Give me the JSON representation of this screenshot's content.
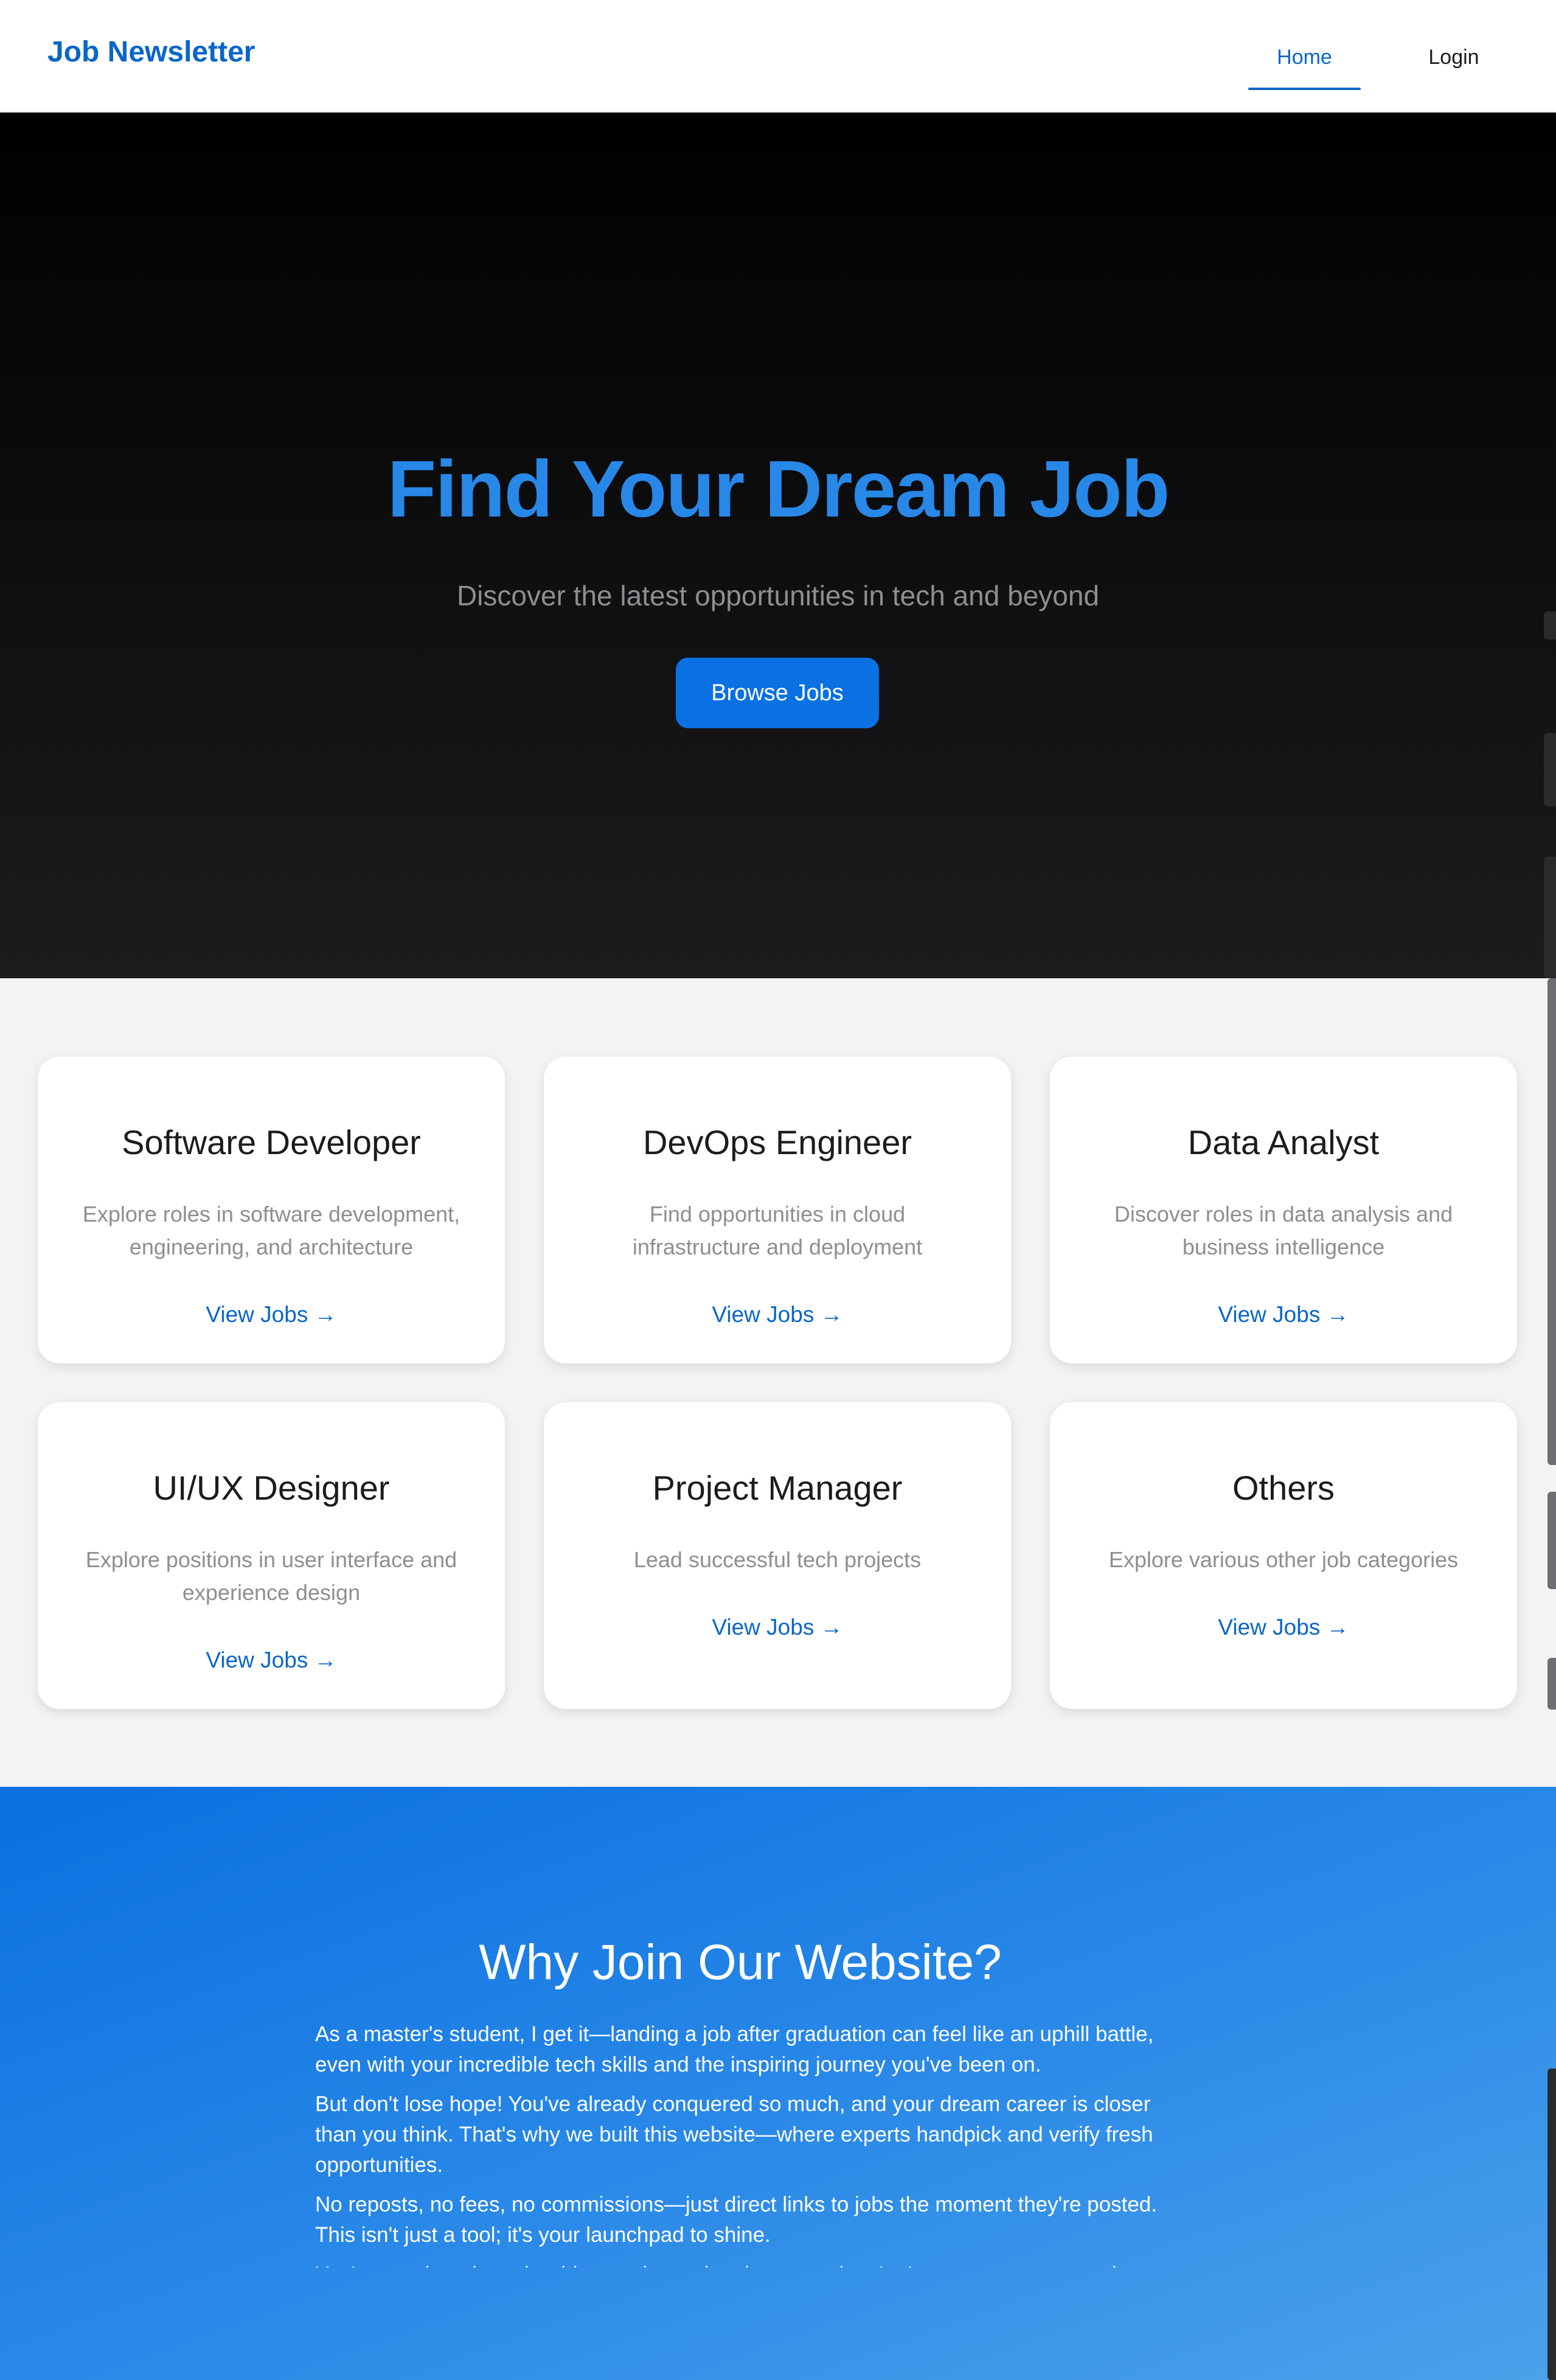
{
  "navbar": {
    "brand": "Job Newsletter",
    "links": [
      {
        "label": "Home",
        "active": true
      },
      {
        "label": "Login",
        "active": false
      }
    ]
  },
  "hero": {
    "title": "Find Your Dream Job",
    "subtitle": "Discover the latest opportunities in tech and beyond",
    "button_label": "Browse Jobs"
  },
  "categories": [
    {
      "title": "Software Developer",
      "description": "Explore roles in software development, engineering, and architecture",
      "link_label": "View Jobs →"
    },
    {
      "title": "DevOps Engineer",
      "description": "Find opportunities in cloud infrastructure and deployment",
      "link_label": "View Jobs →"
    },
    {
      "title": "Data Analyst",
      "description": "Discover roles in data analysis and business intelligence",
      "link_label": "View Jobs →"
    },
    {
      "title": "UI/UX Designer",
      "description": "Explore positions in user interface and experience design",
      "link_label": "View Jobs →"
    },
    {
      "title": "Project Manager",
      "description": "Lead successful tech projects",
      "link_label": "View Jobs →"
    },
    {
      "title": "Others",
      "description": "Explore various other job categories",
      "link_label": "View Jobs →"
    }
  ],
  "why": {
    "title": "Why Join Our Website?",
    "paragraphs": [
      "As a master's student, I get it—landing a job after graduation can feel like an uphill battle, even with your incredible tech skills and the inspiring journey you've been on.",
      "But don't lose hope! You've already conquered so much, and your dream career is closer than you think. That's why we built this website—where experts handpick and verify fresh opportunities.",
      "No reposts, no fees, no commissions—just direct links to jobs the moment they're posted. This isn't just a tool; it's your launchpad to shine.",
      "You've got the talent, the drive, and now the chance to rise. Let's grow stronger together and turn your hard work into success!"
    ]
  },
  "colors": {
    "accent": "#0a66c8",
    "hero_title": "#2788e8",
    "button": "#0a71e3",
    "muted_text": "#8e8e93"
  }
}
